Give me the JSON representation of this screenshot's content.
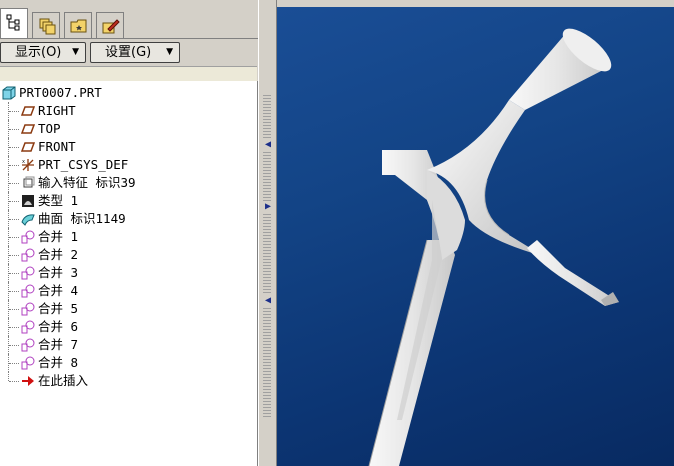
{
  "window": {
    "title": ""
  },
  "tabs": [
    {
      "name": "model-tree"
    },
    {
      "name": "layers"
    },
    {
      "name": "folder-browser"
    },
    {
      "name": "favorites"
    }
  ],
  "toolbar": {
    "display_label": "显示(O)",
    "settings_label": "设置(G)"
  },
  "tree": {
    "root": "PRT0007.PRT",
    "items": [
      {
        "label": "RIGHT",
        "icon": "datum-plane-icon"
      },
      {
        "label": "TOP",
        "icon": "datum-plane-icon"
      },
      {
        "label": "FRONT",
        "icon": "datum-plane-icon"
      },
      {
        "label": "PRT_CSYS_DEF",
        "icon": "csys-icon"
      },
      {
        "label": "输入特征 标识39",
        "icon": "import-feature-icon"
      },
      {
        "label": "类型 1",
        "icon": "type-feature-icon"
      },
      {
        "label": "曲面 标识1149",
        "icon": "surface-icon"
      },
      {
        "label": "合并 1",
        "icon": "merge-icon"
      },
      {
        "label": "合并 2",
        "icon": "merge-icon"
      },
      {
        "label": "合并 3",
        "icon": "merge-icon"
      },
      {
        "label": "合并 4",
        "icon": "merge-icon"
      },
      {
        "label": "合并 5",
        "icon": "merge-icon"
      },
      {
        "label": "合并 6",
        "icon": "merge-icon"
      },
      {
        "label": "合并 7",
        "icon": "merge-icon"
      },
      {
        "label": "合并 8",
        "icon": "merge-icon"
      },
      {
        "label": "在此插入",
        "icon": "insert-here-icon"
      }
    ]
  },
  "colors": {
    "viewport_bg": "#134486",
    "part_surface": "#e8e8e8",
    "plane_icon": "#8b3a10",
    "merge_icon": "#b040c0",
    "insert_arrow": "#d01010"
  }
}
